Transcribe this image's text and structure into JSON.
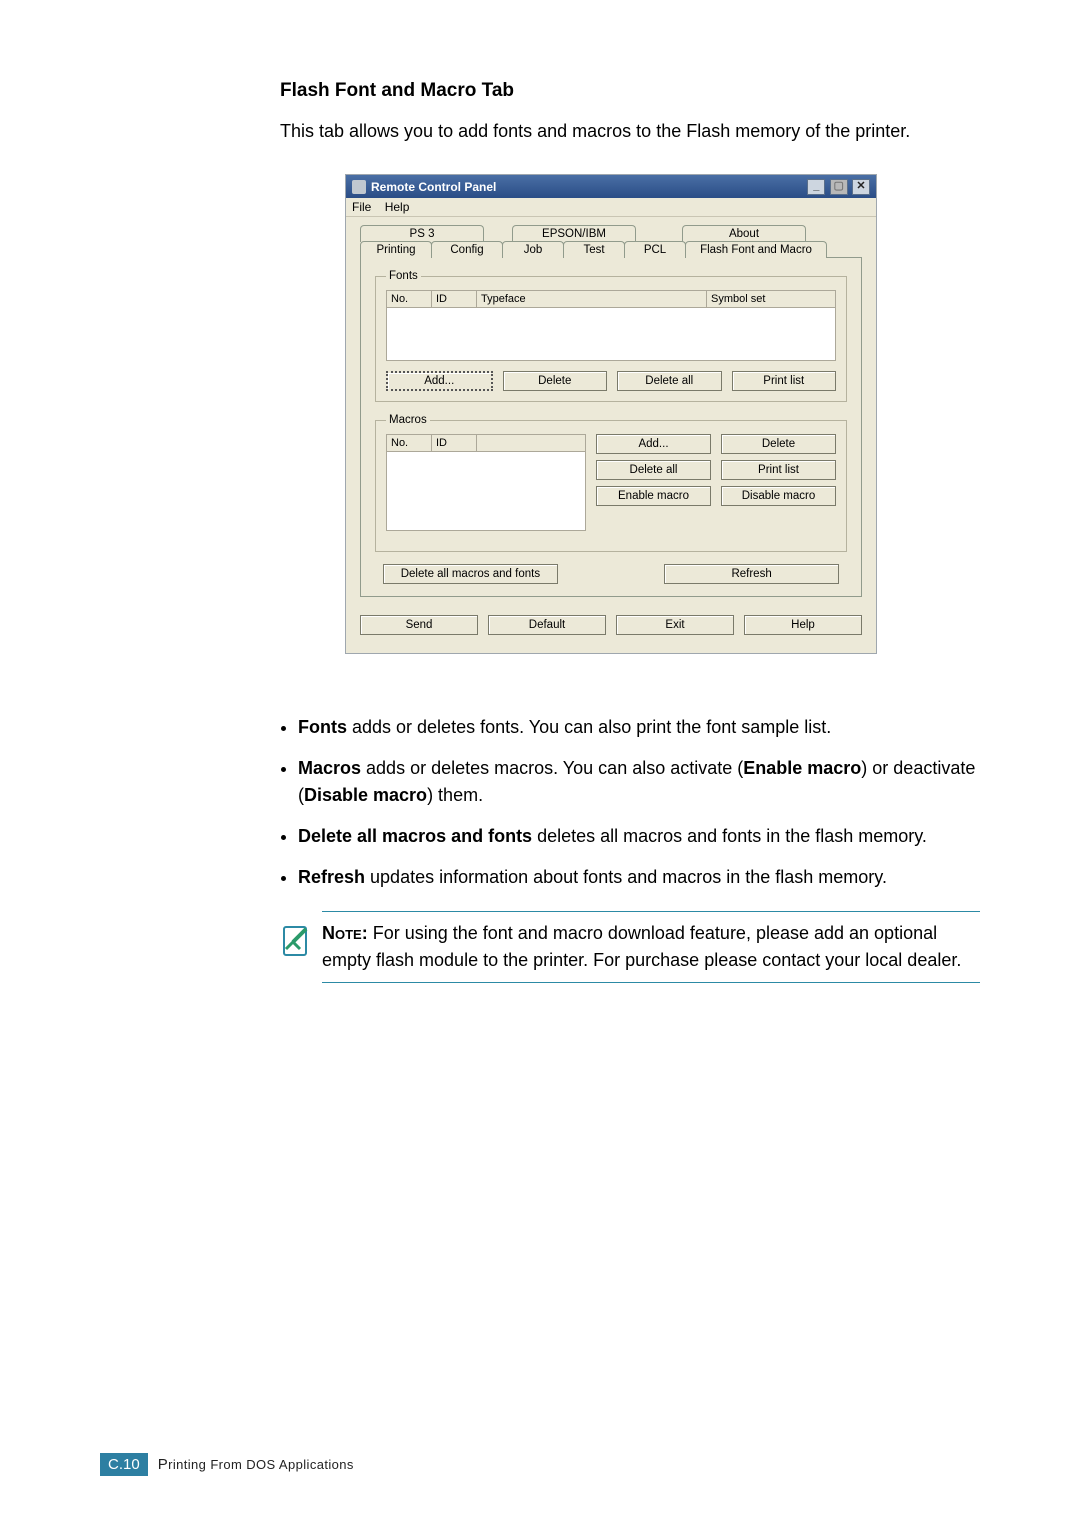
{
  "section_title": "Flash Font and Macro Tab",
  "intro": "This tab allows you to add fonts and macros to the Flash memory of the printer.",
  "window": {
    "title": "Remote Control Panel",
    "menu": {
      "file": "File",
      "help": "Help"
    },
    "tabs_row1": {
      "ps3": "PS 3",
      "epson": "EPSON/IBM",
      "about": "About"
    },
    "tabs_row2": {
      "printing": "Printing",
      "config": "Config",
      "job": "Job",
      "test": "Test",
      "pcl": "PCL",
      "flash": "Flash Font and Macro"
    },
    "fonts_group": {
      "legend": "Fonts",
      "cols": {
        "no": "No.",
        "id": "ID",
        "typeface": "Typeface",
        "symbolset": "Symbol set"
      },
      "buttons": {
        "add": "Add...",
        "delete": "Delete",
        "delete_all": "Delete all",
        "print_list": "Print list"
      }
    },
    "macros_group": {
      "legend": "Macros",
      "cols": {
        "no": "No.",
        "id": "ID"
      },
      "buttons": {
        "add": "Add...",
        "delete": "Delete",
        "delete_all": "Delete all",
        "print_list": "Print list",
        "enable": "Enable macro",
        "disable": "Disable macro"
      }
    },
    "global": {
      "delete_all_macros_fonts": "Delete all macros and fonts",
      "refresh": "Refresh"
    },
    "bottom": {
      "send": "Send",
      "default": "Default",
      "exit": "Exit",
      "help": "Help"
    }
  },
  "bullets": {
    "fonts_b": "Fonts",
    "fonts_t": " adds or deletes fonts. You can also print the font sample list.",
    "macros_b": "Macros",
    "macros_t1": " adds or deletes macros. You can also activate (",
    "macros_b2": "Enable macro",
    "macros_t2": ") or deactivate (",
    "macros_b3": "Disable macro",
    "macros_t3": ") them.",
    "delall_b": "Delete all macros and fonts",
    "delall_t": " deletes all macros and fonts in the flash memory.",
    "refresh_b": "Refresh",
    "refresh_t": " updates information about fonts and macros in the flash memory."
  },
  "note": {
    "label": "Note:",
    "text": " For using the font and macro download feature, please add an optional empty flash module to the printer. For purchase please contact your local dealer."
  },
  "footer": {
    "page_prefix": "C.",
    "page_number": "10",
    "title_pre": "P",
    "title_rest": "rinting From DOS Applications"
  }
}
